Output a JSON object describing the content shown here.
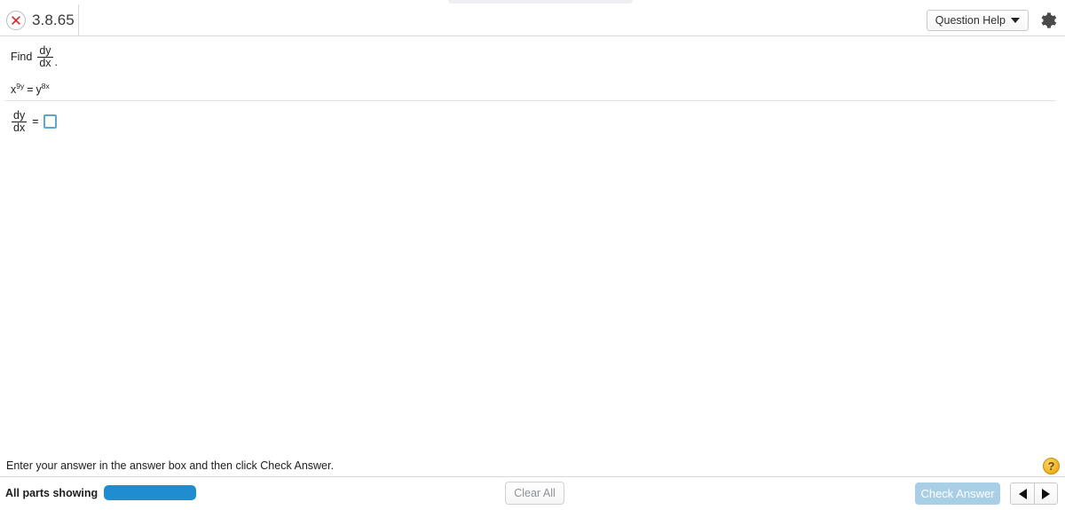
{
  "header": {
    "status_icon": "error-x-icon",
    "question_number": "3.8.65",
    "question_help_label": "Question Help",
    "settings_icon": "gear-icon"
  },
  "problem": {
    "prompt_lead": "Find",
    "prompt_fraction": {
      "numerator": "dy",
      "denominator": "dx"
    },
    "prompt_period": ".",
    "equation": {
      "left_base": "x",
      "left_exponent": "9y",
      "relation": "=",
      "right_base": "y",
      "right_exponent": "8x"
    },
    "answer": {
      "fraction": {
        "numerator": "dy",
        "denominator": "dx"
      },
      "equals": "=",
      "input_value": "",
      "input_placeholder": ""
    }
  },
  "instruction": {
    "text": "Enter your answer in the answer box and then click Check Answer.",
    "help_icon_label": "?"
  },
  "footer": {
    "parts_label": "All parts showing",
    "progress_percent": 100,
    "clear_all_label": "Clear All",
    "check_answer_label": "Check Answer",
    "prev_icon": "triangle-left-icon",
    "next_icon": "triangle-right-icon"
  },
  "colors": {
    "accent_blue": "#1f8dd0",
    "check_button": "#a9cfe6",
    "answer_box_border": "#5ba8cc",
    "error_red": "#d81f26",
    "help_yellow": "#f0ad20"
  }
}
